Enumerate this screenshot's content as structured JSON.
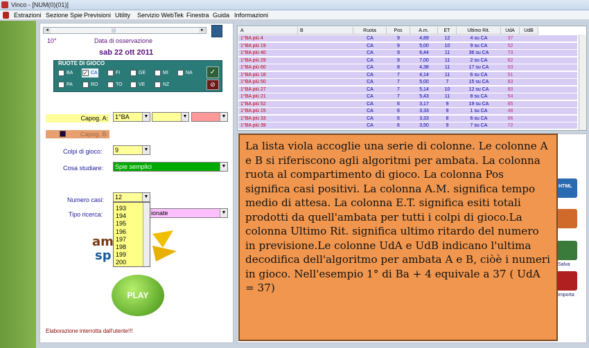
{
  "window": {
    "title": "Vinco - [NUM(0)(01)]"
  },
  "menu": [
    "Estrazioni",
    "Sezione Spie",
    "Previsioni",
    "Utility",
    "Servizio WebTek",
    "Finestra",
    "Guida",
    "Informazioni"
  ],
  "left": {
    "draw_number": "10°",
    "obs_label": "Data di osservazione",
    "date": "sab 22 ott 2011",
    "ruote_title": "RUOTE DI GIOCO",
    "ruote": [
      {
        "name": "BA",
        "checked": false
      },
      {
        "name": "CA",
        "checked": true
      },
      {
        "name": "FI",
        "checked": false
      },
      {
        "name": "GE",
        "checked": false
      },
      {
        "name": "MI",
        "checked": false
      },
      {
        "name": "NA",
        "checked": false
      },
      {
        "name": "PA",
        "checked": false
      },
      {
        "name": "RO",
        "checked": false
      },
      {
        "name": "TO",
        "checked": false
      },
      {
        "name": "VE",
        "checked": false
      },
      {
        "name": "NZ",
        "checked": false
      }
    ],
    "capog_a_label": "Capog. A:",
    "capog_a_value": "1°BA",
    "capog_b_label": "Capog. B:",
    "colpi_label": "Colpi di gioco:",
    "colpi_value": "9",
    "cosa_label": "Cosa studiare:",
    "cosa_value": "Spie semplici",
    "casi_label": "Numero casi:",
    "casi_value": "12",
    "tipo_label": "Tipo ricerca:",
    "tipo_value": "ionate",
    "casi_options": [
      "193",
      "194",
      "195",
      "196",
      "197",
      "198",
      "199",
      "200"
    ],
    "play_label": "PLAY",
    "status": "Elaborazione interrotta dall'utente!!!"
  },
  "table": {
    "headers": [
      "A",
      "B",
      "Ruota",
      "Pos",
      "A.m.",
      "ET",
      "Ultimo Rit.",
      "UdA",
      "UdB"
    ],
    "rows": [
      [
        "1°BA  più 4",
        "",
        "CA",
        "9",
        "4,89",
        "12",
        "4 su CA",
        "37",
        ""
      ],
      [
        "1°BA  più 19",
        "",
        "CA",
        "9",
        "5,00",
        "10",
        "9 su CA",
        "52",
        ""
      ],
      [
        "1°BA  più 40",
        "",
        "CA",
        "9",
        "6,44",
        "11",
        "36 su CA",
        "73",
        ""
      ],
      [
        "1°BA  più 29",
        "",
        "CA",
        "9",
        "7,00",
        "11",
        "2 su CA",
        "62",
        ""
      ],
      [
        "1°BA  più 60",
        "",
        "CA",
        "8",
        "4,38",
        "11",
        "17 su CA",
        "03",
        ""
      ],
      [
        "1°BA  più 18",
        "",
        "CA",
        "7",
        "4,14",
        "11",
        "6 su CA",
        "51",
        ""
      ],
      [
        "1°BA  più 50",
        "",
        "CA",
        "7",
        "5,00",
        "7",
        "15 su CA",
        "83",
        ""
      ],
      [
        "1°BA  più 27",
        "",
        "CA",
        "7",
        "5,14",
        "10",
        "12 su CA",
        "60",
        ""
      ],
      [
        "1°BA  più 21",
        "",
        "CA",
        "7",
        "5,43",
        "11",
        "8 su CA",
        "54",
        ""
      ],
      [
        "1°BA  più 52",
        "",
        "CA",
        "6",
        "3,17",
        "9",
        "19 su CA",
        "85",
        ""
      ],
      [
        "1°BA  più 15",
        "",
        "CA",
        "6",
        "3,33",
        "9",
        "1 su CA",
        "48",
        ""
      ],
      [
        "1°BA  più 33",
        "",
        "CA",
        "6",
        "3,33",
        "8",
        "6 su CA",
        "66",
        ""
      ],
      [
        "1°BA  più 39",
        "",
        "CA",
        "6",
        "3,50",
        "9",
        "7 su CA",
        "72",
        ""
      ]
    ]
  },
  "side": {
    "salva": "Salva",
    "importa": "Importa",
    "html": "HTML"
  },
  "note": "La lista viola accoglie una serie di colonne. Le colonne A e B si riferiscono agli algoritmi per ambata. La colonna ruota al compartimento di gioco. La colonna Pos significa casi positivi. La colonna A.M. significa tempo medio di attesa. La colonna E.T. significa esiti totali prodotti da quell'ambata per tutti i colpi di gioco.La colonna Ultimo Rit. significa ultimo ritardo del numero in previsione.Le colonne UdA e UdB indicano l'ultima decodifica dell'algoritmo per ambata A e B, ciòè i numeri in gioco. Nell'esempio 1° di Ba + 4 equivale a 37 ( UdA = 37)"
}
